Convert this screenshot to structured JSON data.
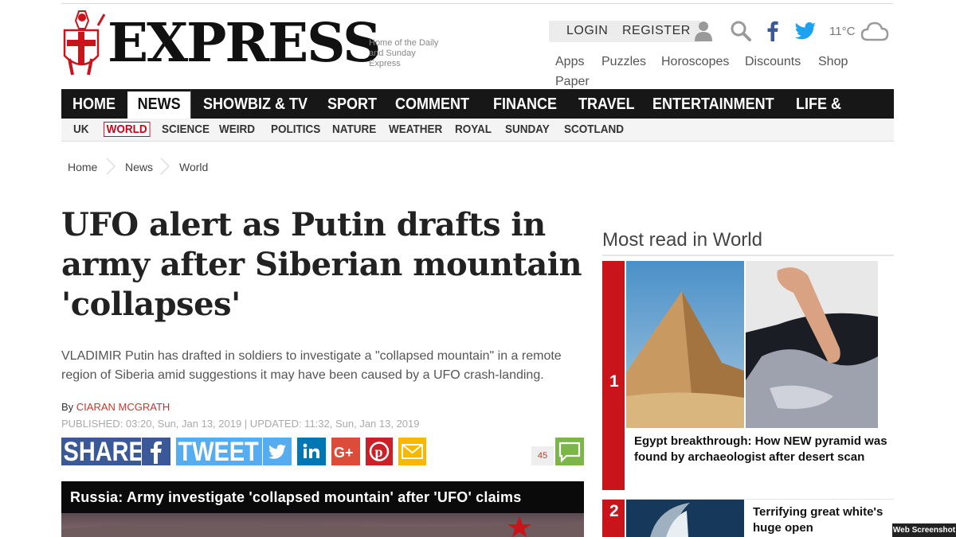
{
  "masthead": {
    "logo_text": "EXPRESS",
    "tagline": "Home of the Daily and Sunday Express"
  },
  "userbar": {
    "login": "LOGIN",
    "register": "REGISTER",
    "temperature": "11°C"
  },
  "utility_links": [
    "Apps",
    "Puzzles",
    "Horoscopes",
    "Discounts",
    "Shop",
    "Paper"
  ],
  "main_nav": [
    "HOME",
    "NEWS",
    "SHOWBIZ & TV",
    "SPORT",
    "COMMENT",
    "FINANCE",
    "TRAVEL",
    "ENTERTAINMENT",
    "LIFE & STYLE"
  ],
  "main_nav_active": "NEWS",
  "sub_nav": [
    "UK",
    "WORLD",
    "SCIENCE",
    "WEIRD",
    "POLITICS",
    "NATURE",
    "WEATHER",
    "ROYAL",
    "SUNDAY",
    "SCOTLAND"
  ],
  "sub_nav_active": "WORLD",
  "breadcrumb": [
    "Home",
    "News",
    "World"
  ],
  "article": {
    "headline": "UFO alert as Putin drafts in army after Siberian mountain 'collapses'",
    "standfirst": "VLADIMIR Putin has drafted in soldiers to investigate a \"collapsed mountain\" in a remote region of Siberia amid suggestions it may have been caused by a UFO crash-landing.",
    "by": "By",
    "author": "CIARAN MCGRATH",
    "published": "PUBLISHED: 03:20, Sun, Jan 13, 2019 | UPDATED: 11:32, Sun, Jan 13, 2019",
    "share_label": "SHARE",
    "tweet_label": "TWEET",
    "comment_count": "45",
    "video_title": "Russia: Army investigate 'collapsed mountain' after 'UFO' claims"
  },
  "sidebar": {
    "title": "Most read in World",
    "items": [
      {
        "rank": "1",
        "headline": "Egypt breakthrough: How NEW pyramid was found by archaeologist after desert scan"
      },
      {
        "rank": "2",
        "headline": "Terrifying great white's huge open"
      }
    ]
  },
  "watermark": "Web Screenshot",
  "colors": {
    "brand_red": "#c9141c",
    "nav_black": "#171717",
    "facebook": "#3b5998",
    "twitter": "#1da1f2",
    "linkedin": "#0077b5",
    "googleplus": "#dd4b39",
    "pinterest": "#cb2027",
    "email": "#f6b800",
    "comment_green": "#7ab648"
  }
}
